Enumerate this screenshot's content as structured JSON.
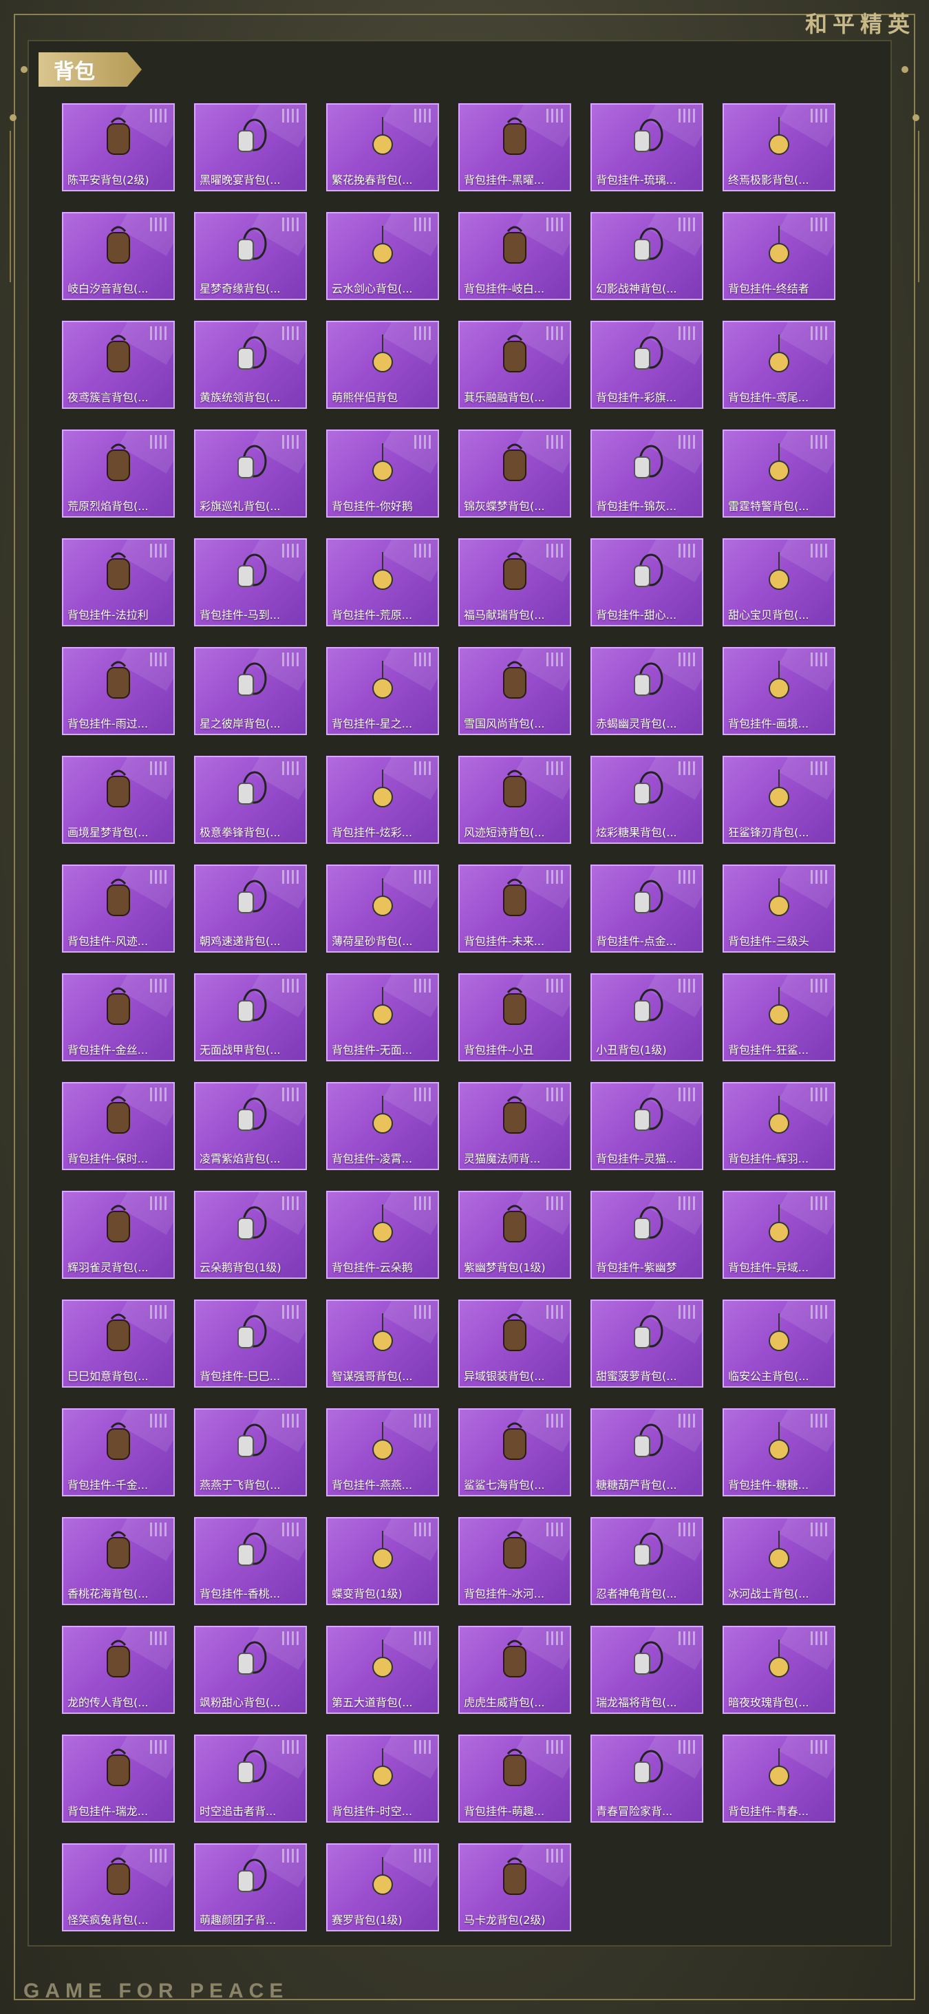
{
  "brand": {
    "logo_text": "和平精英",
    "footer_text": "GAME FOR PEACE"
  },
  "section": {
    "title": "背包"
  },
  "items": [
    "陈平安背包(2级)",
    "黑曜晚宴背包(...",
    "繁花挽春背包(...",
    "背包挂件-黑曜...",
    "背包挂件-琉璃...",
    "终焉极影背包(...",
    "岐白汐音背包(...",
    "星梦奇缘背包(...",
    "云水剑心背包(...",
    "背包挂件-岐白...",
    "幻影战神背包(...",
    "背包挂件-终结者",
    "夜鸢簇言背包(...",
    "黄族统领背包(...",
    "萌熊伴侣背包",
    "萁乐融融背包(...",
    "背包挂件-彩旗...",
    "背包挂件-鸢尾...",
    "荒原烈焰背包(...",
    "彩旗巡礼背包(...",
    "背包挂件-你好鹅",
    "锦灰蝶梦背包(...",
    "背包挂件-锦灰...",
    "雷霆特警背包(...",
    "背包挂件-法拉利",
    "背包挂件-马到...",
    "背包挂件-荒原...",
    "福马献瑞背包(...",
    "背包挂件-甜心...",
    "甜心宝贝背包(...",
    "背包挂件-雨过...",
    "星之彼岸背包(...",
    "背包挂件-星之...",
    "雪国风尚背包(...",
    "赤蝎幽灵背包(...",
    "背包挂件-画境...",
    "画境星梦背包(...",
    "极意拳锋背包(...",
    "背包挂件-炫彩...",
    "风迹短诗背包(...",
    "炫彩糖果背包(...",
    "狂鲨锋刃背包(...",
    "背包挂件-风迹...",
    "朝鸡速递背包(...",
    "薄荷星砂背包(...",
    "背包挂件-未来...",
    "背包挂件-点金...",
    "背包挂件-三级头",
    "背包挂件-金丝...",
    "无面战甲背包(...",
    "背包挂件-无面...",
    "背包挂件-小丑",
    "小丑背包(1级)",
    "背包挂件-狂鲨...",
    "背包挂件-保时...",
    "凌霄紫焰背包(...",
    "背包挂件-凌霄...",
    "灵猫魔法师背...",
    "背包挂件-灵猫...",
    "背包挂件-辉羽...",
    "辉羽雀灵背包(...",
    "云朵鹅背包(1级)",
    "背包挂件-云朵鹅",
    "紫幽梦背包(1级)",
    "背包挂件-紫幽梦",
    "背包挂件-异域...",
    "巳巳如意背包(...",
    "背包挂件-巳巳...",
    "智谋强哥背包(...",
    "异域银装背包(...",
    "甜蜜菠萝背包(...",
    "临安公主背包(...",
    "背包挂件-千金...",
    "燕燕于飞背包(...",
    "背包挂件-燕燕...",
    "鲨鲨七海背包(...",
    "糖糖葫芦背包(...",
    "背包挂件-糖糖...",
    "香桃花海背包(...",
    "背包挂件-香桃...",
    "蝶变背包(1级)",
    "背包挂件-冰河...",
    "忍者神龟背包(...",
    "冰河战士背包(...",
    "龙的传人背包(...",
    "飒粉甜心背包(...",
    "第五大道背包(...",
    "虎虎生威背包(...",
    "瑞龙福将背包(...",
    "暗夜玫瑰背包(...",
    "背包挂件-瑞龙...",
    "时空追击者背...",
    "背包挂件-时空...",
    "背包挂件-萌趣...",
    "青春冒险家背...",
    "背包挂件-青春...",
    "怪笑疯兔背包(...",
    "萌趣颜团子背...",
    "赛罗背包(1级)",
    "马卡龙背包(2级)"
  ]
}
